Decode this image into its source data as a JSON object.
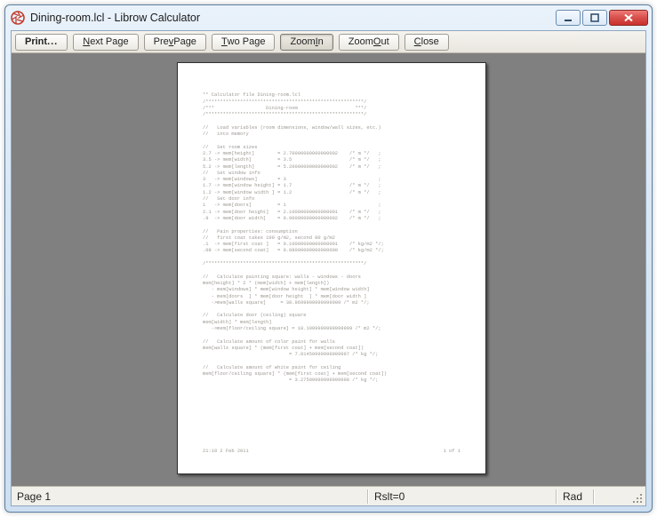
{
  "window": {
    "title": "Dining-room.lcl - Librow Calculator",
    "app_icon": "aperture-icon"
  },
  "caption": {
    "minimize": "minimize",
    "maximize": "maximize",
    "close": "close"
  },
  "toolbar": {
    "print": {
      "label": "Print",
      "ellipsis": "..."
    },
    "next_page": {
      "pre": "",
      "ul": "N",
      "post": "ext Page"
    },
    "prev_page": {
      "pre": "Pre",
      "ul": "v",
      "post": " Page"
    },
    "two_page": {
      "pre": "",
      "ul": "T",
      "post": "wo Page"
    },
    "zoom_in": {
      "pre": "Zoom ",
      "ul": "I",
      "post": "n",
      "active": true
    },
    "zoom_out": {
      "pre": "Zoom ",
      "ul": "O",
      "post": "ut"
    },
    "close": {
      "pre": "",
      "ul": "C",
      "post": "lose"
    }
  },
  "document": {
    "header_comment": "** Calculator file Dining-room.lcl",
    "body": "/*******************************************************/\n/***                  Dining-room                    ***/\n/*******************************************************/\n\n//   Load variables (room dimensions, window/wall sizes, etc.)\n//   into memory\n\n//   Set room sizes\n2.7 -> mem[height]        = 2.70000000000000002    /* m */   ;\n3.5 -> mem[width]         = 3.5                    /* m */   ;\n5.2 -> mem[length]        = 5.20000000000000002    /* m */   ;\n//   Set window info\n3   -> mem[windows]       = 3                                ;\n1.7 -> mem[window height] = 1.7                    /* m */   ;\n1.2 -> mem[window width ] = 1.2                    /* m */   ;\n//   Set door info\n1   -> mem[doors]         = 1                                ;\n2.1 -> mem[door height]   = 2.10000000000000001    /* m */   ;\n.9  -> mem[door width]    = 0.90000000000000002    /* m */   ;\n\n//   Pain properties: consumption\n//   first coat takes 100 g/m2, second 80 g/m2\n.1  -> mem[first coat ]   = 0.10000000000000001    /* kg/m2 */;\n.08 -> mem[second coat]   = 0.08000000000000000    /* kg/m2 */;\n\n/*******************************************************/\n\n//   Calculate painting square: walls - windows - doors\nmem[height] * 2 * (mem[width] + mem[length])\n   - mem[windows] * mem[window height] * mem[window width]\n   - mem[doors  ] * mem[door height  ] * mem[door width ]\n   ->mem[walls square]     = 38.9699999999999999 /* m2 */;\n\n//   Calculate door (ceiling) square\nmem[width] * mem[length]\n   ->mem[floor/ceiling square] = 18.1999999999999999 /* m2 */;\n\n//   Calculate amount of color paint for walls\nmem[walls square] * (mem[first coat] + mem[second coat])\n                              = 7.01459999999999997 /* kg */;\n\n//   Calculate amount of white paint for ceiling\nmem[floor/ceiling square] * (mem[first coat] + mem[second coat])\n                              = 3.27599999999999998 /* kg */;",
    "footer_left": "21:10 2 Feb 2011",
    "footer_right": "1 of 1"
  },
  "status": {
    "page": "Page 1",
    "rslt": "Rslt=0",
    "mode": "Rad"
  }
}
